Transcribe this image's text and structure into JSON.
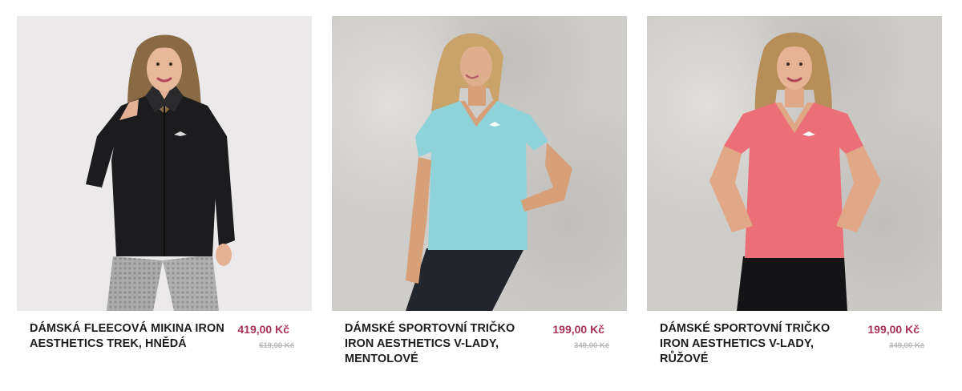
{
  "products": [
    {
      "name": "DÁMSKÁ FLEECOVÁ MIKINA IRON AESTHETICS TREK, HNĚDÁ",
      "price": "419,00 Kč",
      "old_price": "619,00 Kč",
      "garment_color": "#1c1c1e"
    },
    {
      "name": "DÁMSKÉ SPORTOVNÍ TRIČKO IRON AESTHETICS V-LADY, MENTOLOVÉ",
      "price": "199,00 Kč",
      "old_price": "349,00 Kč",
      "garment_color": "#8ed3da"
    },
    {
      "name": "DÁMSKÉ SPORTOVNÍ TRIČKO IRON AESTHETICS V-LADY, RŮŽOVÉ",
      "price": "199,00 Kč",
      "old_price": "349,00 Kč",
      "garment_color": "#ec6f78"
    }
  ],
  "colors": {
    "price": "#a8325a",
    "old_price": "#b8b8b8",
    "title": "#1c1c1c"
  }
}
